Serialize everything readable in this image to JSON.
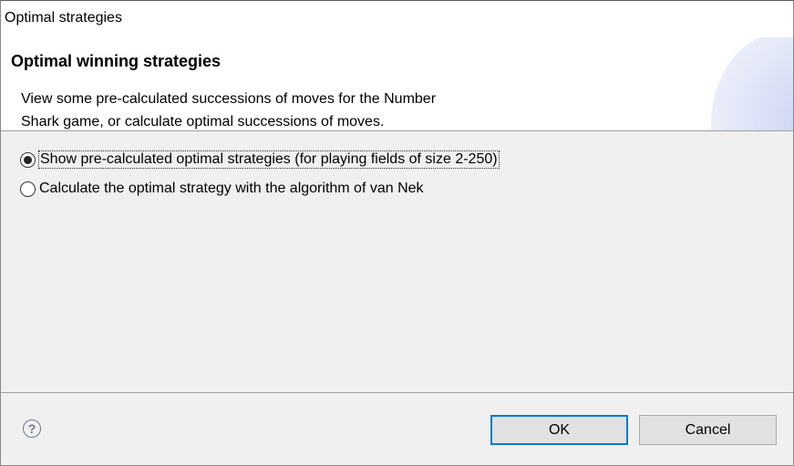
{
  "window": {
    "title": "Optimal strategies"
  },
  "header": {
    "title": "Optimal winning strategies",
    "description_line1": "View some pre-calculated successions of moves for the Number",
    "description_line2": "Shark game, or calculate optimal successions of moves."
  },
  "options": [
    {
      "label": "Show pre-calculated optimal strategies (for playing fields of size 2-250)",
      "selected": true
    },
    {
      "label": "Calculate the optimal strategy with the algorithm of van Nek",
      "selected": false
    }
  ],
  "footer": {
    "help_icon": "question-circle-icon",
    "ok_label": "OK",
    "cancel_label": "Cancel"
  },
  "colors": {
    "focus_accent": "#0078d7"
  }
}
